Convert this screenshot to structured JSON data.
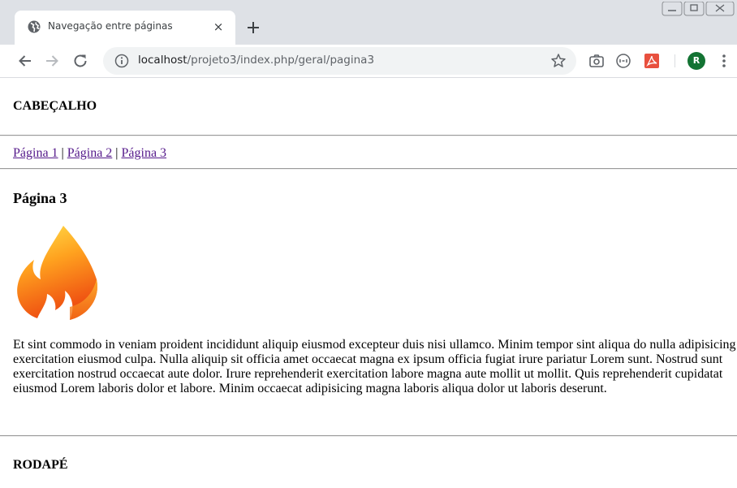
{
  "browser": {
    "tab_title": "Navegação entre páginas",
    "tab_close_glyph": "×",
    "url_host": "localhost",
    "url_path": "/projeto3/index.php/geral/pagina3",
    "avatar_letter": "R",
    "icons": {
      "favicon": "globe-icon",
      "new_tab": "plus-icon",
      "back": "back-arrow-icon",
      "forward": "forward-arrow-icon",
      "reload": "reload-icon",
      "site_info": "info-icon",
      "bookmark": "star-icon",
      "extensions": [
        "camera-icon",
        "tab-capture-icon",
        "pdf-icon"
      ],
      "menu": "kebab-menu-icon",
      "window_controls": [
        "minimize-icon",
        "restore-icon",
        "close-window-icon"
      ]
    },
    "colors": {
      "tabstrip": "#dee1e6",
      "omnibox": "#f1f3f4",
      "avatar": "#137333"
    }
  },
  "page": {
    "header": "CABEÇALHO",
    "nav": {
      "links": [
        "Página 1",
        "Página 2",
        "Página 3"
      ],
      "separator": " | "
    },
    "heading": "Página 3",
    "logo_icon": "codeigniter-flame-logo",
    "paragraph": "Et sint commodo in veniam proident incididunt aliquip eiusmod excepteur duis nisi ullamco. Minim tempor sint aliqua do nulla adipisicing exercitation eiusmod culpa. Nulla aliquip sit officia amet occaecat magna ex ipsum officia fugiat irure pariatur Lorem sunt. Nostrud sunt exercitation nostrud occaecat aute dolor. Irure reprehenderit exercitation labore magna aute mollit ut mollit. Quis reprehenderit cupidatat eiusmod Lorem laboris dolor et labore. Minim occaecat adipisicing magna laboris aliqua dolor ut laboris deserunt.",
    "footer": "RODAPÉ",
    "colors": {
      "visited_link": "#551a8b",
      "rule": "#9a9a9a"
    }
  }
}
